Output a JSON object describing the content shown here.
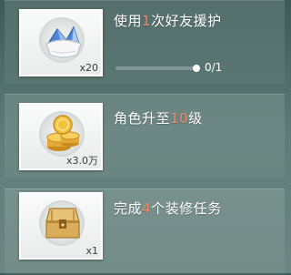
{
  "tasks": [
    {
      "title_pre": "使用",
      "title_num": "1",
      "title_post": "次好友援护",
      "reward_qty": "x20",
      "reward_icon": "crystal-pouch-icon",
      "progress_text": "0/1",
      "progress_fraction": 0
    },
    {
      "title_pre": "角色升至",
      "title_num": "10",
      "title_post": "级",
      "reward_qty": "x3.0万",
      "reward_icon": "gold-coins-icon"
    },
    {
      "title_pre": "完成",
      "title_num": "4",
      "title_post": "个装修任务",
      "reward_qty": "x1",
      "reward_icon": "treasure-chest-icon"
    }
  ],
  "colors": {
    "highlight": "#ef8a67",
    "text": "#ffffff"
  }
}
